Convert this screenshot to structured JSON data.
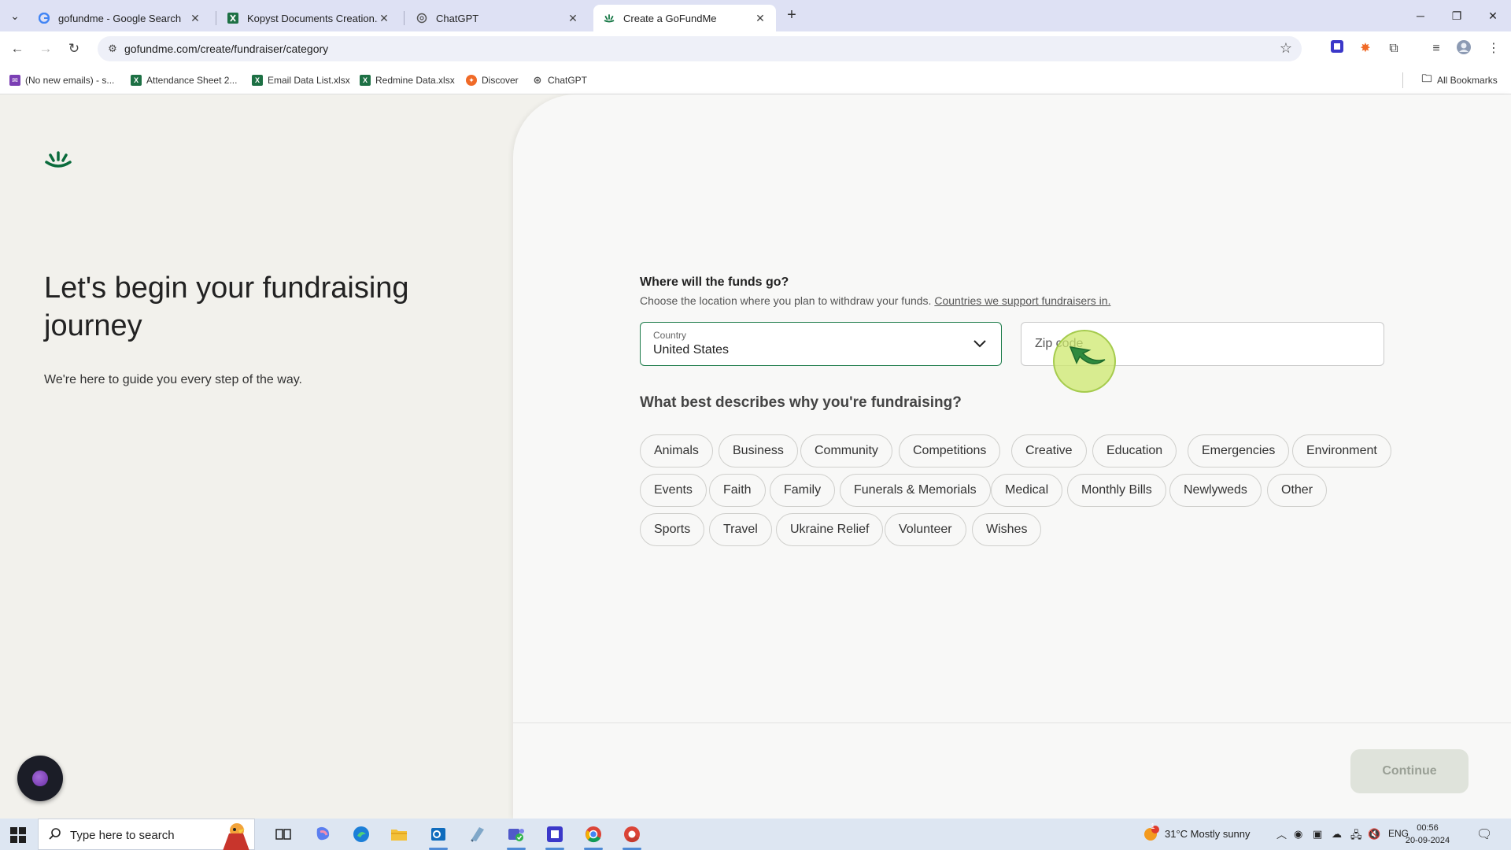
{
  "browser": {
    "tabs": [
      {
        "title": "gofundme - Google Search",
        "icon": "google-icon"
      },
      {
        "title": "Kopyst Documents Creation.xlsx",
        "icon": "excel-icon"
      },
      {
        "title": "ChatGPT",
        "icon": "chatgpt-icon"
      },
      {
        "title": "Create a GoFundMe",
        "icon": "gofundme-icon",
        "active": true
      }
    ],
    "url": "gofundme.com/create/fundraiser/category",
    "bookmarks": [
      {
        "label": "(No new emails) - s...",
        "icon": "gmail-icon"
      },
      {
        "label": "Attendance Sheet 2...",
        "icon": "excel-icon"
      },
      {
        "label": "Email Data List.xlsx",
        "icon": "excel-icon"
      },
      {
        "label": "Redmine Data.xlsx",
        "icon": "excel-icon"
      },
      {
        "label": "Discover",
        "icon": "discover-icon"
      },
      {
        "label": "ChatGPT",
        "icon": "chatgpt-icon"
      }
    ],
    "all_bookmarks": "All Bookmarks"
  },
  "hero": {
    "title": "Let's begin your fundraising journey",
    "subtitle": "We're here to guide you every step of the way."
  },
  "location": {
    "heading": "Where will the funds go?",
    "description": "Choose the location where you plan to withdraw your funds.",
    "link": "Countries we support fundraisers in.",
    "country_label": "Country",
    "country_value": "United States",
    "zip_placeholder": "Zip code"
  },
  "category": {
    "question": "What best describes why you're fundraising?",
    "options": [
      "Animals",
      "Business",
      "Community",
      "Competitions",
      "Creative",
      "Education",
      "Emergencies",
      "Environment",
      "Events",
      "Faith",
      "Family",
      "Funerals & Memorials",
      "Medical",
      "Monthly Bills",
      "Newlyweds",
      "Other",
      "Sports",
      "Travel",
      "Ukraine Relief",
      "Volunteer",
      "Wishes"
    ]
  },
  "actions": {
    "continue": "Continue"
  },
  "colors": {
    "brand": "#1a7a48",
    "continue_disabled_bg": "#dfe3db"
  },
  "taskbar": {
    "search_placeholder": "Type here to search",
    "weather": "31°C  Mostly sunny",
    "weather_badge": "1",
    "language": "ENG",
    "time": "00:56",
    "date": "20-09-2024"
  }
}
